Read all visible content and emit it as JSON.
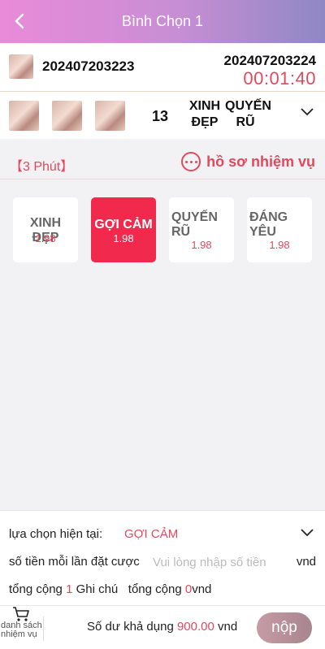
{
  "header": {
    "title": "Bình Chọn 1",
    "back_icon": "chevron-left-icon"
  },
  "period": {
    "current_id": "202407203223",
    "next_id": "202407203224",
    "countdown": "00:01:40"
  },
  "last_result": {
    "number": "13",
    "label1": "XINH ĐẸP",
    "label2": "QUYẾN RŨ"
  },
  "rules": {
    "minutes_label": "【3 Phút】",
    "history_label": "hồ sơ nhiệm vụ"
  },
  "options": [
    {
      "name": "XINH ĐẸP",
      "odds": "1.98",
      "selected": false
    },
    {
      "name": "GỢI CẢM",
      "odds": "1.98",
      "selected": true
    },
    {
      "name": "QUYẾN RŨ",
      "odds": "1.98",
      "selected": false
    },
    {
      "name": "ĐÁNG YÊU",
      "odds": "1.98",
      "selected": false
    }
  ],
  "bet": {
    "current_choice_label": "lựa chọn hiện tại:",
    "current_choice_value": "GỢI CẢM",
    "amount_label": "số tiền mỗi lần đặt cược",
    "amount_placeholder": "Vui lòng nhập số tiền",
    "amount_unit": "vnd",
    "total_prefix": "tổng cộng",
    "total_count": "1",
    "total_note": "Ghi chú",
    "total_prefix2": "tổng cộng",
    "total_amount": "0",
    "total_unit": "vnd"
  },
  "footer": {
    "tasks_label": "danh sách nhiệm vụ",
    "balance_label": "Số dư khả dụng",
    "balance_value": "900.00",
    "balance_unit": "vnd",
    "submit_label": "nộp"
  },
  "colors": {
    "accent": "#e2495d",
    "selected": "#f0294d"
  }
}
